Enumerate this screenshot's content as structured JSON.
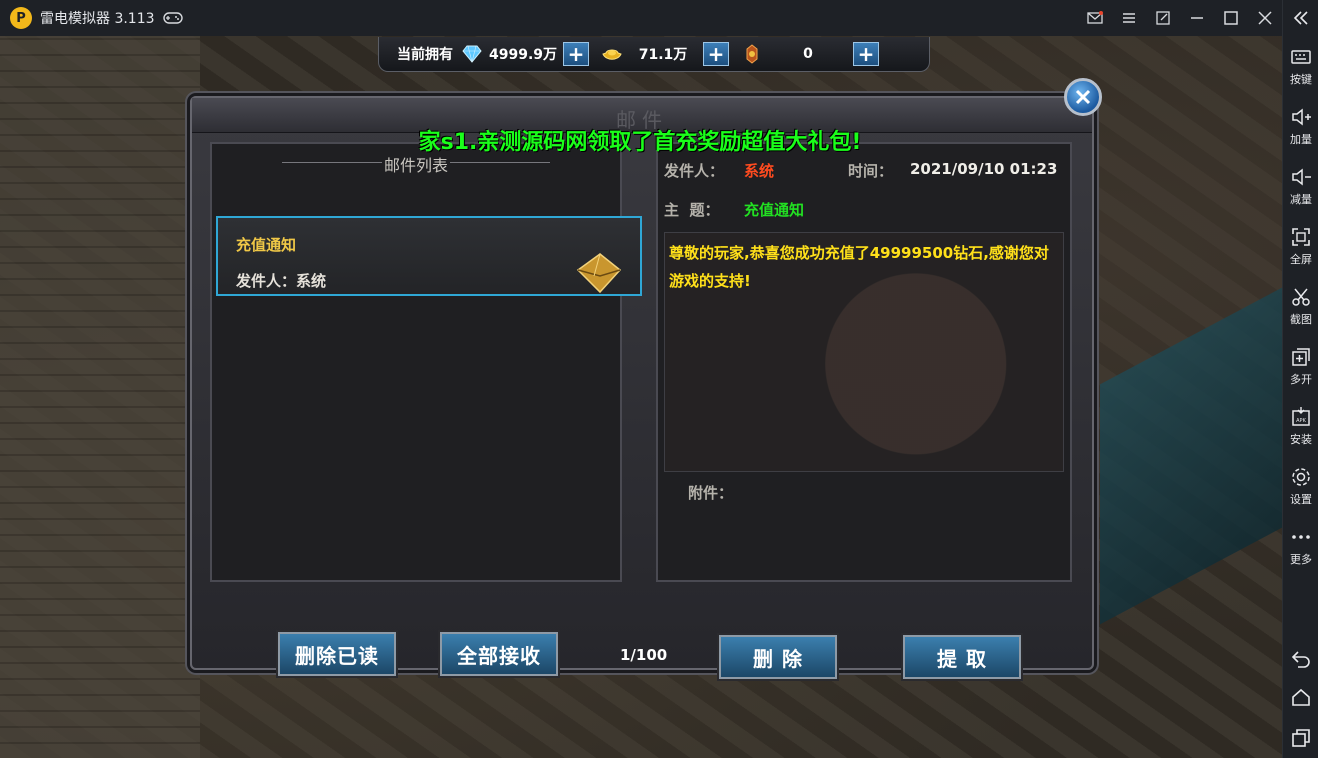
{
  "titlebar": {
    "app_name": "雷电模拟器 3.113",
    "logo_letter": "P"
  },
  "sidebar": {
    "items": [
      {
        "label": "按键",
        "icon": "keyboard-icon"
      },
      {
        "label": "加量",
        "icon": "volume-up-icon"
      },
      {
        "label": "减量",
        "icon": "volume-down-icon"
      },
      {
        "label": "全屏",
        "icon": "fullscreen-icon"
      },
      {
        "label": "截图",
        "icon": "scissors-icon"
      },
      {
        "label": "多开",
        "icon": "multi-instance-icon"
      },
      {
        "label": "安装",
        "icon": "apk-install-icon"
      },
      {
        "label": "设置",
        "icon": "gear-icon"
      },
      {
        "label": "更多",
        "icon": "more-dots-icon"
      }
    ]
  },
  "currency": {
    "label": "当前拥有",
    "diamond": "4999.9万",
    "gold": "71.1万",
    "token": "0",
    "plus": "+"
  },
  "marquee": "家s1.亲测源码网领取了首充奖励超值大礼包!",
  "mail": {
    "title": "邮件",
    "list_header": "邮件列表",
    "items": [
      {
        "subject": "充值通知",
        "sender": "发件人：系统"
      }
    ],
    "detail": {
      "sender_label": "发件人：",
      "sender": "系统",
      "time_label": "时间：",
      "time": "2021/09/10 01:23",
      "subject_label": "主  题：",
      "subject": "充值通知",
      "body": "尊敬的玩家,恭喜您成功充值了49999500钻石,感谢您对游戏的支持!",
      "attachment_label": "附件："
    },
    "buttons": {
      "delete_read": "删除已读",
      "receive_all": "全部接收",
      "delete": "删 除",
      "extract": "提 取"
    },
    "page": "1/100"
  }
}
